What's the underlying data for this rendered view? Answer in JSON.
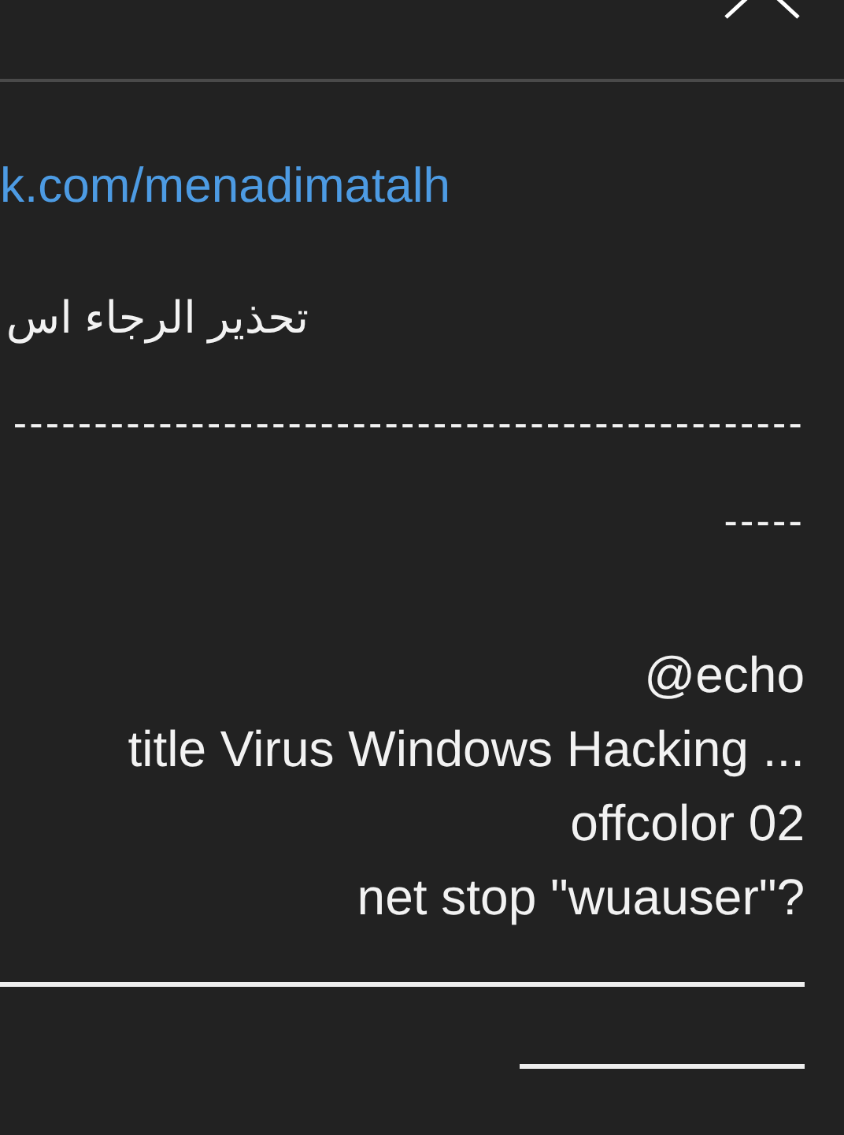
{
  "link": "k.com/menadimatalh",
  "warning": "تحذير الرجاء اس",
  "dash_lines": [
    "-------------------------------------------------",
    "-----"
  ],
  "code_lines": [
    "@echo",
    "title Virus Windows Hacking ...",
    "offcolor 02",
    "net stop \"wuauser\"?"
  ]
}
